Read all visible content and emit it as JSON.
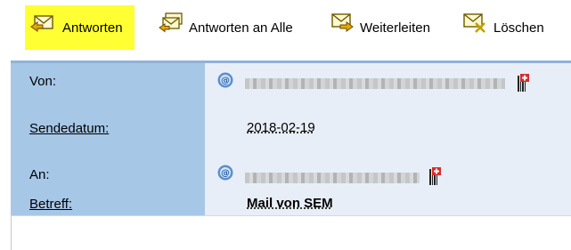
{
  "toolbar": {
    "reply_label": "Antworten",
    "reply_all_label": "Antworten an Alle",
    "forward_label": "Weiterleiten",
    "delete_label": "Löschen",
    "active_highlight": "#ffff33"
  },
  "header": {
    "from_label": "Von:",
    "date_label": "Sendedatum:",
    "date_value": "2018-02-19",
    "to_label": "An:",
    "subject_label": "Betreff:",
    "subject_value": "Mail von SEM"
  },
  "colors": {
    "label_column": "#a7c7e7",
    "value_panel": "#e8eef8",
    "panel_border": "#8fb3d9"
  },
  "icons": {
    "reply": "envelope-reply-icon",
    "reply_all": "envelope-reply-all-icon",
    "forward": "envelope-forward-icon",
    "delete": "envelope-delete-icon",
    "sender": "at-sign-icon",
    "recipient": "at-sign-icon",
    "contact": "contact-card-icon"
  }
}
